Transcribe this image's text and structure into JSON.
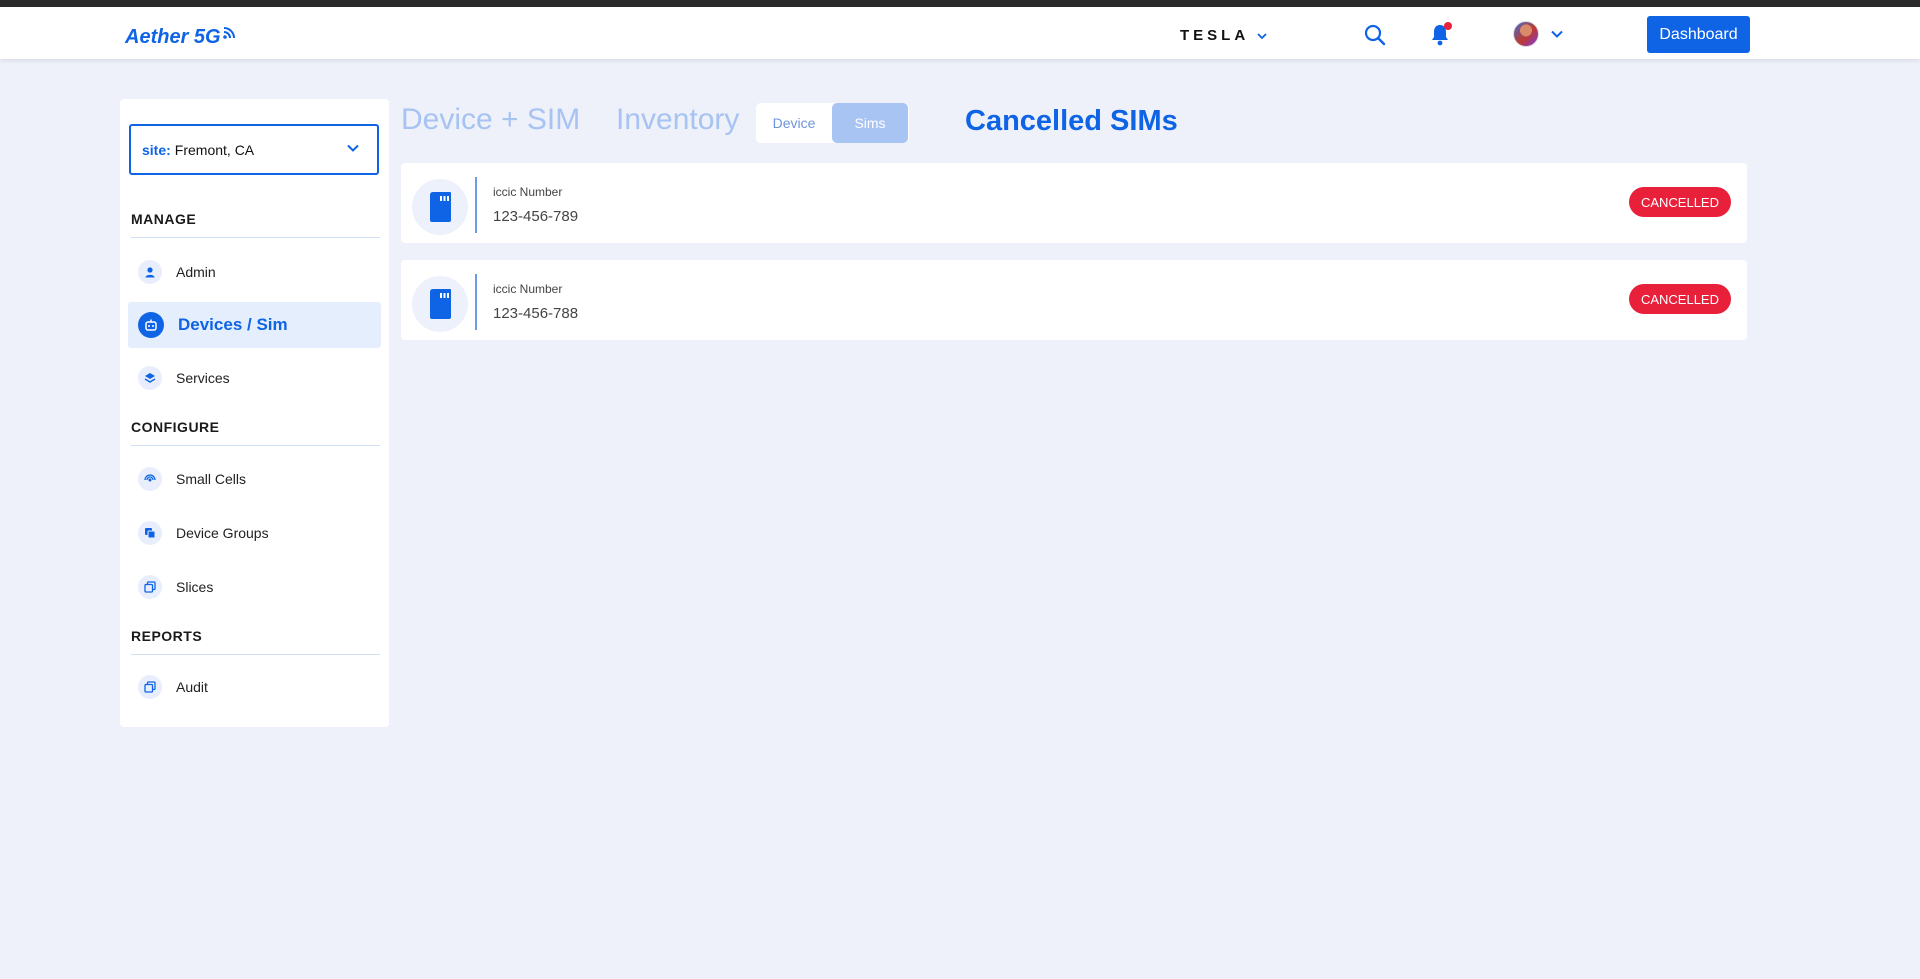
{
  "header": {
    "logo_text": "Aether 5G",
    "org_name": "TESLA",
    "dashboard_label": "Dashboard",
    "has_notification": true
  },
  "sidebar": {
    "site_label": "site:",
    "site_value": "Fremont, CA",
    "sections": [
      {
        "title": "MANAGE",
        "items": [
          {
            "label": "Admin",
            "icon": "person-icon"
          },
          {
            "label": "Devices / Sim",
            "icon": "robot-icon",
            "active": true
          },
          {
            "label": "Services",
            "icon": "layers-icon"
          }
        ]
      },
      {
        "title": "CONFIGURE",
        "items": [
          {
            "label": "Small Cells",
            "icon": "signal-icon"
          },
          {
            "label": "Device Groups",
            "icon": "stack-icon"
          },
          {
            "label": "Slices",
            "icon": "copy-icon"
          }
        ]
      },
      {
        "title": "REPORTS",
        "items": [
          {
            "label": "Audit",
            "icon": "copy-icon"
          }
        ]
      }
    ]
  },
  "main": {
    "tabs": [
      "Device + SIM",
      "Inventory"
    ],
    "segment": {
      "options": [
        "Device",
        "Sims"
      ],
      "selected": "Sims"
    },
    "title": "Cancelled SIMs",
    "sims": [
      {
        "label": "iccic Number",
        "number": "123-456-789",
        "status": "CANCELLED"
      },
      {
        "label": "iccic Number",
        "number": "123-456-788",
        "status": "CANCELLED"
      }
    ]
  },
  "colors": {
    "accent": "#0f64e6",
    "badge": "#e8203a",
    "background": "#eef1fa",
    "muted_tab": "#a7c3f2"
  }
}
